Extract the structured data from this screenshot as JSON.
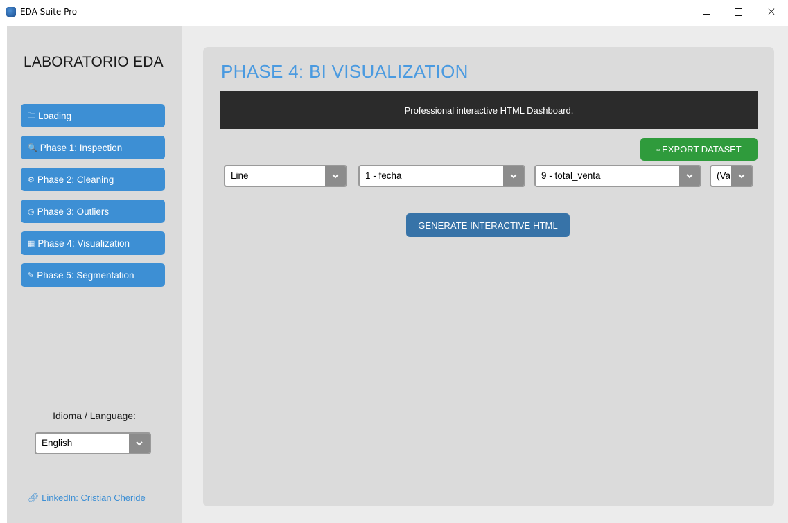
{
  "window": {
    "title": "EDA Suite Pro",
    "controls": {
      "minimize": "minimize",
      "maximize": "maximize",
      "close": "×"
    }
  },
  "sidebar": {
    "brand": "LABORATORIO EDA",
    "items": [
      {
        "label": "Loading",
        "icon": "folder-icon",
        "glyph": "🗀"
      },
      {
        "label": "Phase 1: Inspection",
        "icon": "search-icon",
        "glyph": "🔍"
      },
      {
        "label": "Phase 2: Cleaning",
        "icon": "gear-icon",
        "glyph": "⚙"
      },
      {
        "label": "Phase 3: Outliers",
        "icon": "target-icon",
        "glyph": "◎"
      },
      {
        "label": "Phase 4: Visualization",
        "icon": "chart-icon",
        "glyph": "▦"
      },
      {
        "label": "Phase 5: Segmentation",
        "icon": "brush-icon",
        "glyph": "✎"
      }
    ],
    "language_label": "Idioma / Language:",
    "language_value": "English",
    "linkedin": "LinkedIn: Cristian Cheride"
  },
  "main": {
    "title": "PHASE 4: BI VISUALIZATION",
    "banner": "Professional interactive HTML Dashboard.",
    "export_label": "EXPORT DATASET",
    "chart_type": "Line",
    "x_column": "1 - fecha",
    "y_column": "9 - total_venta",
    "extra_column": "(Va",
    "generate_label": "GENERATE INTERACTIVE HTML"
  },
  "colors": {
    "accent": "#3d8fd4",
    "title": "#4a9ae0",
    "export": "#2f9b3c",
    "generate": "#3773a8",
    "banner": "#2b2b2b"
  }
}
